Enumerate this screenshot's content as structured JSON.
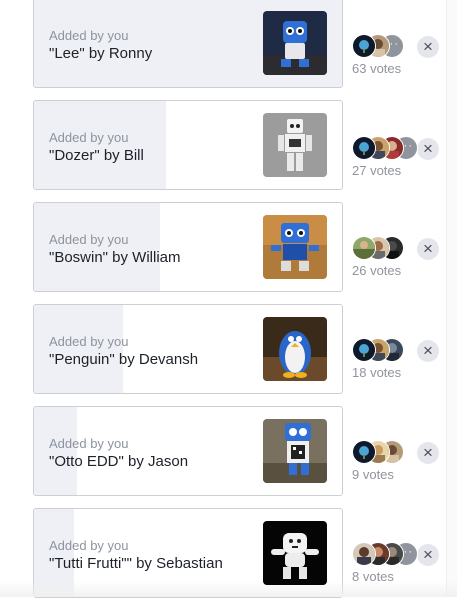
{
  "poll": {
    "options": [
      {
        "added_by": "Added by you",
        "title": "\"Lee\" by Ronny",
        "votes": "63 votes",
        "share": 1.0,
        "thumb": "blue-robot-photo",
        "voters": [
          "avatar-globe",
          "avatar-photo",
          "more-voters"
        ]
      },
      {
        "added_by": "Added by you",
        "title": "\"Dozer\" by Bill",
        "votes": "27 votes",
        "share": 0.43,
        "thumb": "white-robot-photo",
        "voters": [
          "avatar-globe",
          "avatar-photo",
          "avatar-red",
          "more-voters"
        ]
      },
      {
        "added_by": "Added by you",
        "title": "\"Boswin\" by William",
        "votes": "26 votes",
        "share": 0.41,
        "thumb": "blue-robot-photo",
        "voters": [
          "avatar-photo",
          "avatar-photo",
          "avatar-dark"
        ]
      },
      {
        "added_by": "Added by you",
        "title": "\"Penguin\" by Devansh",
        "votes": "18 votes",
        "share": 0.29,
        "thumb": "penguin-robot-photo",
        "voters": [
          "avatar-globe",
          "avatar-photo",
          "avatar-photo"
        ]
      },
      {
        "added_by": "Added by you",
        "title": "\"Otto EDD\" by Jason",
        "votes": "9 votes",
        "share": 0.14,
        "thumb": "otto-robot-photo",
        "voters": [
          "avatar-globe",
          "avatar-photo",
          "avatar-photo"
        ]
      },
      {
        "added_by": "Added by you",
        "title": "\"Tutti Frutti\"\" by Sebastian",
        "votes": "8 votes",
        "share": 0.13,
        "thumb": "white-robot-photo",
        "voters": [
          "avatar-photo",
          "avatar-photo",
          "avatar-photo",
          "more-voters"
        ]
      }
    ],
    "remove_icon": "close-icon",
    "more_glyph": "···"
  },
  "colors": {
    "option_border": "#ccd0d5",
    "vote_fill": "#eef0f5",
    "meta_text": "#8d949e",
    "title_text": "#1d2129"
  }
}
